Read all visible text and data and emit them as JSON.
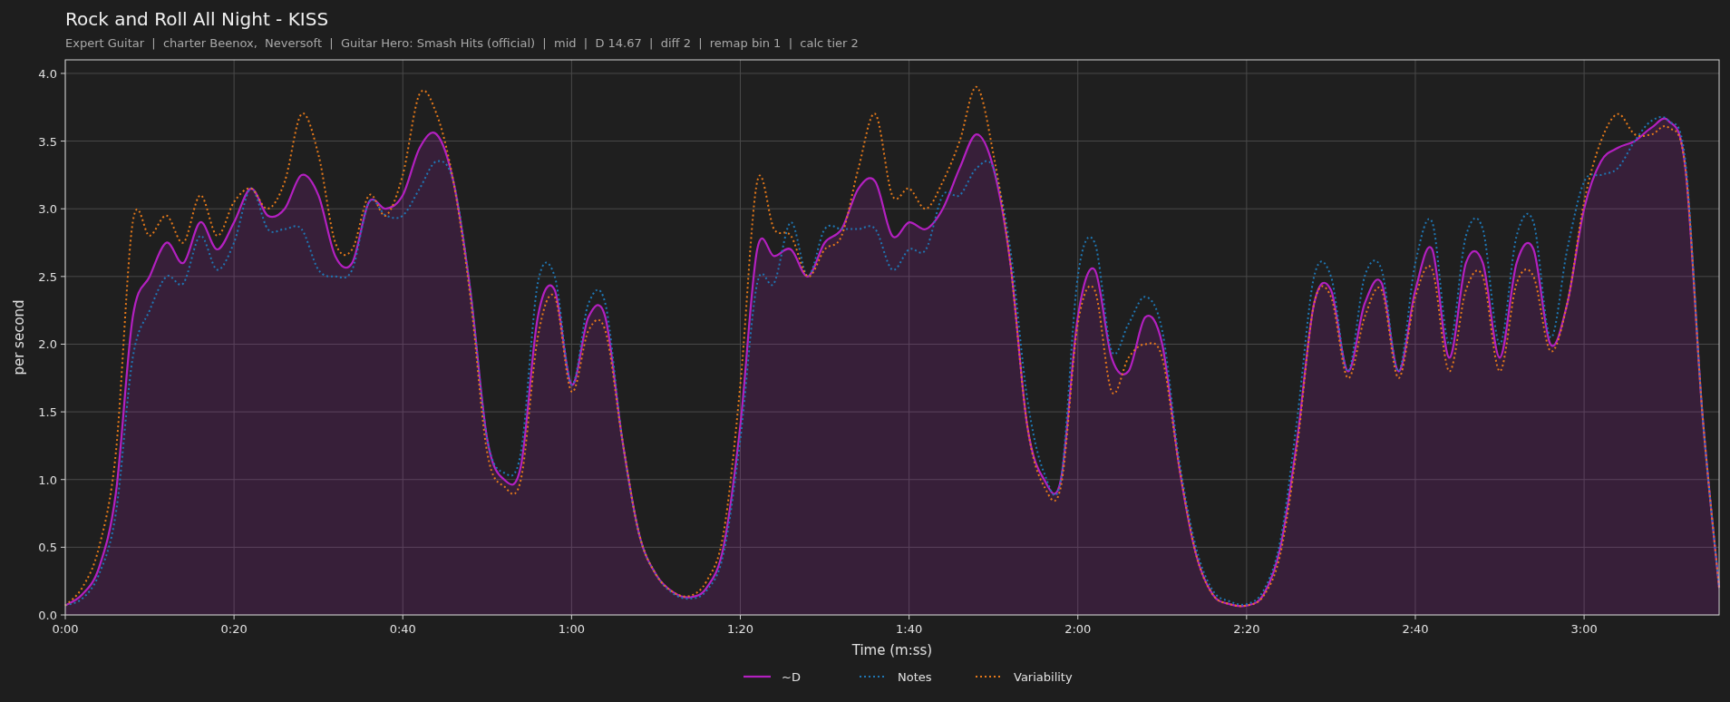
{
  "title": "Rock and Roll All Night - KISS",
  "subtitle": "Expert Guitar  |  charter Beenox,  Neversoft  |  Guitar Hero: Smash Hits (official)  |  mid  |  D 14.67  |  diff 2  |  remap bin 1  |  calc tier 2",
  "chart_data": {
    "type": "line",
    "xlabel": "Time (m:ss)",
    "ylabel": "per second",
    "grid": true,
    "legend": true,
    "xlim": [
      0,
      196
    ],
    "ylim": [
      0,
      4.1
    ],
    "xticks": [
      {
        "value": 0,
        "label": "0:00"
      },
      {
        "value": 20,
        "label": "0:20"
      },
      {
        "value": 40,
        "label": "0:40"
      },
      {
        "value": 60,
        "label": "1:00"
      },
      {
        "value": 80,
        "label": "1:20"
      },
      {
        "value": 100,
        "label": "1:40"
      },
      {
        "value": 120,
        "label": "2:00"
      },
      {
        "value": 140,
        "label": "2:20"
      },
      {
        "value": 160,
        "label": "2:40"
      },
      {
        "value": 180,
        "label": "3:00"
      }
    ],
    "yticks": [
      {
        "value": 0,
        "label": "0.0"
      },
      {
        "value": 0.5,
        "label": "0.5"
      },
      {
        "value": 1,
        "label": "1.0"
      },
      {
        "value": 1.5,
        "label": "1.5"
      },
      {
        "value": 2,
        "label": "2.0"
      },
      {
        "value": 2.5,
        "label": "2.5"
      },
      {
        "value": 3,
        "label": "3.0"
      },
      {
        "value": 3.5,
        "label": "3.5"
      },
      {
        "value": 4,
        "label": "4.0"
      }
    ],
    "x": [
      0,
      2,
      4,
      6,
      8,
      10,
      12,
      14,
      16,
      18,
      20,
      22,
      24,
      26,
      28,
      30,
      32,
      34,
      36,
      38,
      40,
      42,
      44,
      46,
      48,
      50,
      52,
      54,
      56,
      58,
      60,
      62,
      64,
      66,
      68,
      70,
      72,
      74,
      76,
      78,
      80,
      82,
      84,
      86,
      88,
      90,
      92,
      94,
      96,
      98,
      100,
      102,
      104,
      106,
      108,
      110,
      112,
      114,
      116,
      118,
      120,
      122,
      124,
      126,
      128,
      130,
      132,
      134,
      136,
      138,
      140,
      142,
      144,
      146,
      148,
      150,
      152,
      154,
      156,
      158,
      160,
      162,
      164,
      166,
      168,
      170,
      172,
      174,
      176,
      178,
      180,
      182,
      184,
      186,
      188,
      190,
      192,
      194,
      196
    ],
    "series": [
      {
        "name": "~D",
        "color": "#b320c0",
        "type": "area",
        "line_style": "solid",
        "values": [
          0.07,
          0.15,
          0.35,
          0.9,
          2.2,
          2.5,
          2.75,
          2.6,
          2.9,
          2.7,
          2.9,
          3.15,
          2.95,
          3.0,
          3.25,
          3.1,
          2.65,
          2.6,
          3.05,
          3.0,
          3.1,
          3.45,
          3.55,
          3.2,
          2.4,
          1.3,
          1.0,
          1.1,
          2.2,
          2.4,
          1.7,
          2.2,
          2.2,
          1.3,
          0.6,
          0.3,
          0.17,
          0.13,
          0.2,
          0.5,
          1.4,
          2.7,
          2.65,
          2.7,
          2.5,
          2.75,
          2.85,
          3.15,
          3.2,
          2.8,
          2.9,
          2.85,
          3.0,
          3.3,
          3.55,
          3.3,
          2.6,
          1.4,
          1.0,
          1.0,
          2.2,
          2.55,
          1.9,
          1.8,
          2.2,
          2.0,
          1.1,
          0.45,
          0.15,
          0.08,
          0.07,
          0.15,
          0.5,
          1.3,
          2.3,
          2.4,
          1.8,
          2.3,
          2.45,
          1.8,
          2.4,
          2.7,
          1.9,
          2.6,
          2.6,
          1.9,
          2.6,
          2.7,
          2.0,
          2.3,
          3.0,
          3.35,
          3.45,
          3.5,
          3.6,
          3.65,
          3.3,
          1.5,
          0.2
        ]
      },
      {
        "name": "Notes",
        "color": "#1f77b4",
        "line_style": "dotted",
        "values": [
          0.07,
          0.12,
          0.3,
          0.75,
          1.9,
          2.25,
          2.5,
          2.45,
          2.8,
          2.55,
          2.75,
          3.15,
          2.85,
          2.85,
          2.85,
          2.55,
          2.5,
          2.55,
          3.05,
          2.95,
          2.95,
          3.15,
          3.35,
          3.2,
          2.4,
          1.3,
          1.05,
          1.2,
          2.45,
          2.5,
          1.7,
          2.3,
          2.3,
          1.3,
          0.6,
          0.3,
          0.16,
          0.12,
          0.18,
          0.45,
          1.3,
          2.45,
          2.45,
          2.9,
          2.5,
          2.85,
          2.85,
          2.85,
          2.85,
          2.55,
          2.7,
          2.7,
          3.1,
          3.1,
          3.3,
          3.3,
          2.7,
          1.6,
          1.05,
          1.0,
          2.5,
          2.75,
          1.95,
          2.15,
          2.35,
          2.1,
          1.15,
          0.5,
          0.18,
          0.1,
          0.08,
          0.18,
          0.55,
          1.45,
          2.5,
          2.5,
          1.8,
          2.5,
          2.55,
          1.8,
          2.6,
          2.9,
          2.0,
          2.8,
          2.85,
          2.0,
          2.8,
          2.9,
          2.05,
          2.7,
          3.2,
          3.25,
          3.3,
          3.5,
          3.65,
          3.65,
          3.35,
          1.5,
          0.2
        ]
      },
      {
        "name": "Variability",
        "color": "#e5791a",
        "line_style": "dotted",
        "values": [
          0.07,
          0.2,
          0.5,
          1.2,
          2.9,
          2.8,
          2.95,
          2.75,
          3.1,
          2.8,
          3.05,
          3.15,
          3.0,
          3.2,
          3.7,
          3.4,
          2.75,
          2.7,
          3.1,
          2.95,
          3.25,
          3.85,
          3.7,
          3.2,
          2.35,
          1.2,
          0.95,
          1.0,
          2.05,
          2.35,
          1.65,
          2.1,
          2.1,
          1.3,
          0.6,
          0.3,
          0.17,
          0.14,
          0.25,
          0.6,
          1.7,
          3.2,
          2.85,
          2.8,
          2.5,
          2.7,
          2.8,
          3.3,
          3.7,
          3.1,
          3.15,
          3.0,
          3.2,
          3.5,
          3.9,
          3.4,
          2.6,
          1.4,
          0.95,
          0.95,
          2.15,
          2.4,
          1.65,
          1.9,
          2.0,
          1.9,
          1.1,
          0.45,
          0.15,
          0.08,
          0.07,
          0.14,
          0.45,
          1.25,
          2.3,
          2.35,
          1.75,
          2.2,
          2.4,
          1.75,
          2.35,
          2.55,
          1.8,
          2.4,
          2.5,
          1.8,
          2.45,
          2.5,
          1.95,
          2.3,
          3.05,
          3.5,
          3.7,
          3.55,
          3.55,
          3.6,
          3.3,
          1.5,
          0.2
        ]
      }
    ]
  }
}
